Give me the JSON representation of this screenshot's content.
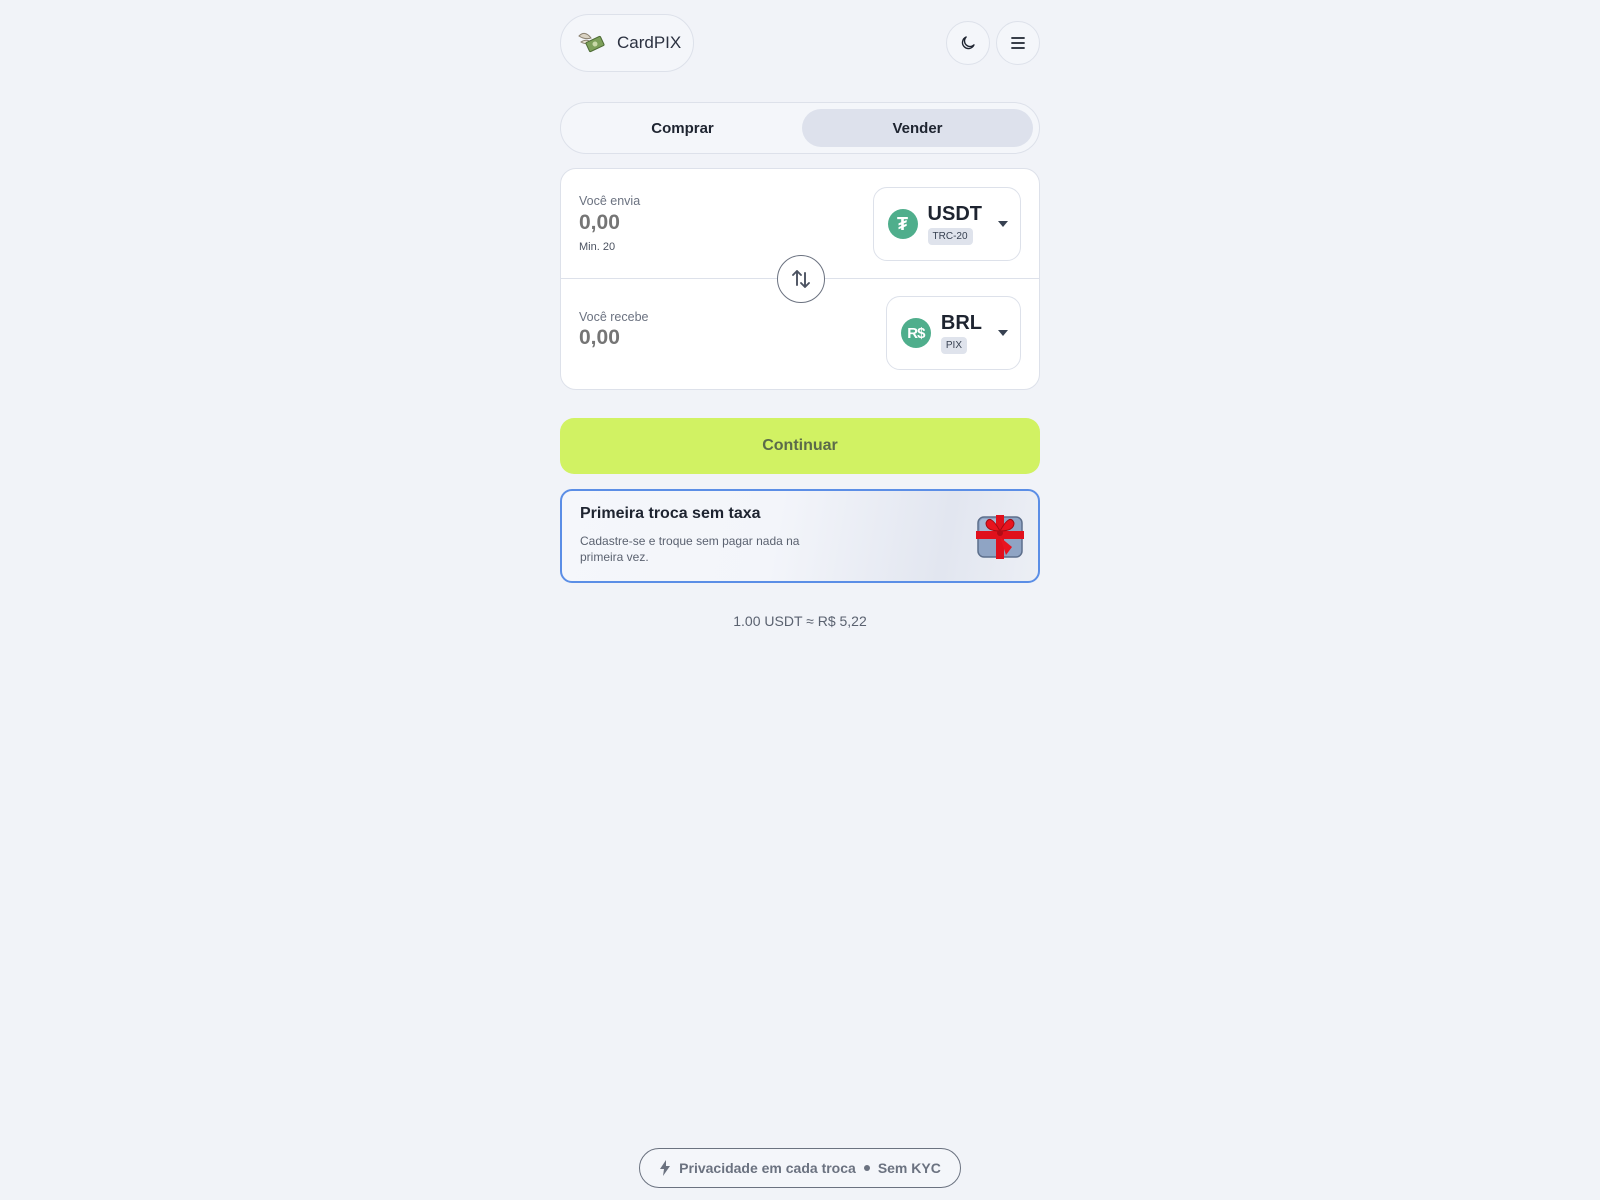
{
  "header": {
    "brand_name": "CardPIX",
    "logo_icon": "money-wings-icon",
    "theme_icon": "moon-icon",
    "menu_icon": "hamburger-menu-icon"
  },
  "tabs": [
    {
      "label": "Comprar",
      "active": false
    },
    {
      "label": "Vender",
      "active": true
    }
  ],
  "send": {
    "label": "Você envia",
    "amount": "0,00",
    "min": "Min. 20",
    "currency": "USDT",
    "network": "TRC-20",
    "icon": "tether-icon"
  },
  "receive": {
    "label": "Você recebe",
    "amount": "0,00",
    "currency": "BRL",
    "network": "PIX",
    "coin_symbol": "R$",
    "icon": "real-icon"
  },
  "swap_icon": "swap-arrows-icon",
  "continue_label": "Continuar",
  "promo": {
    "title": "Primeira troca sem taxa",
    "text": "Cadastre-se e troque sem pagar nada na primeira vez.",
    "icon": "gift-icon"
  },
  "rate": "1.00 USDT ≈ R$ 5,22",
  "footer": {
    "icon": "bolt-icon",
    "privacy": "Privacidade em cada troca",
    "kyc": "Sem KYC"
  },
  "colors": {
    "accent": "#d1f263",
    "coin": "#4fae8c",
    "promo_border": "#5b8ee6",
    "background": "#f1f3f8"
  }
}
